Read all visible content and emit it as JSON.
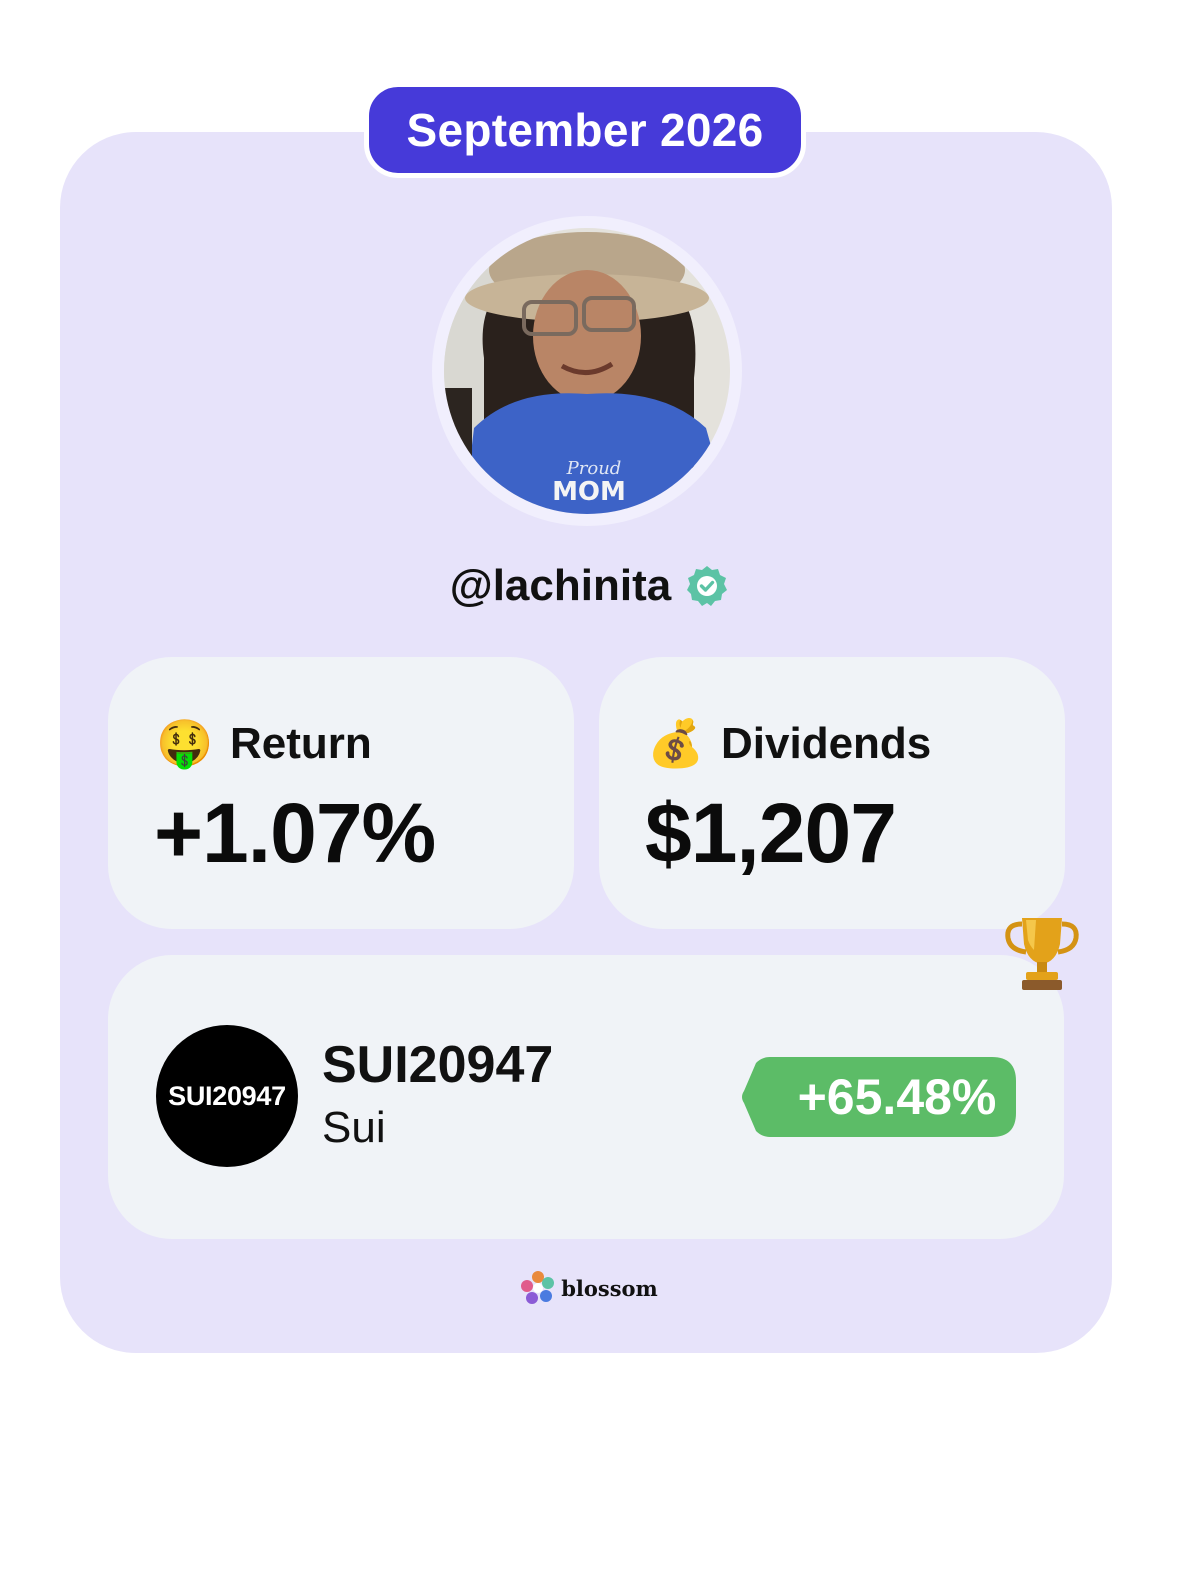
{
  "header": {
    "month_label": "September 2026"
  },
  "profile": {
    "username": "@lachinita",
    "verified_icon": "verified-badge-icon",
    "shirt_text_1": "Proud",
    "shirt_text_2": "MOM"
  },
  "stats": {
    "return": {
      "emoji": "🤑",
      "icon": "money-face-icon",
      "label": "Return",
      "value": "+1.07%"
    },
    "dividends": {
      "emoji": "💰",
      "icon": "money-bag-icon",
      "label": "Dividends",
      "value": "$1,207"
    }
  },
  "top_holding": {
    "icon": "trophy-icon",
    "logo_text": "SUI20947",
    "symbol": "SUI20947",
    "name": "Sui",
    "change": "+65.48%"
  },
  "footer": {
    "brand": "blossom",
    "brand_icon": "blossom-logo-icon"
  },
  "colors": {
    "card_background": "#e7e3fa",
    "pill_background": "#463ad9",
    "tile_background": "#f0f3f7",
    "gain_green": "#5cbc67",
    "verified_teal": "#5cc3a5"
  }
}
